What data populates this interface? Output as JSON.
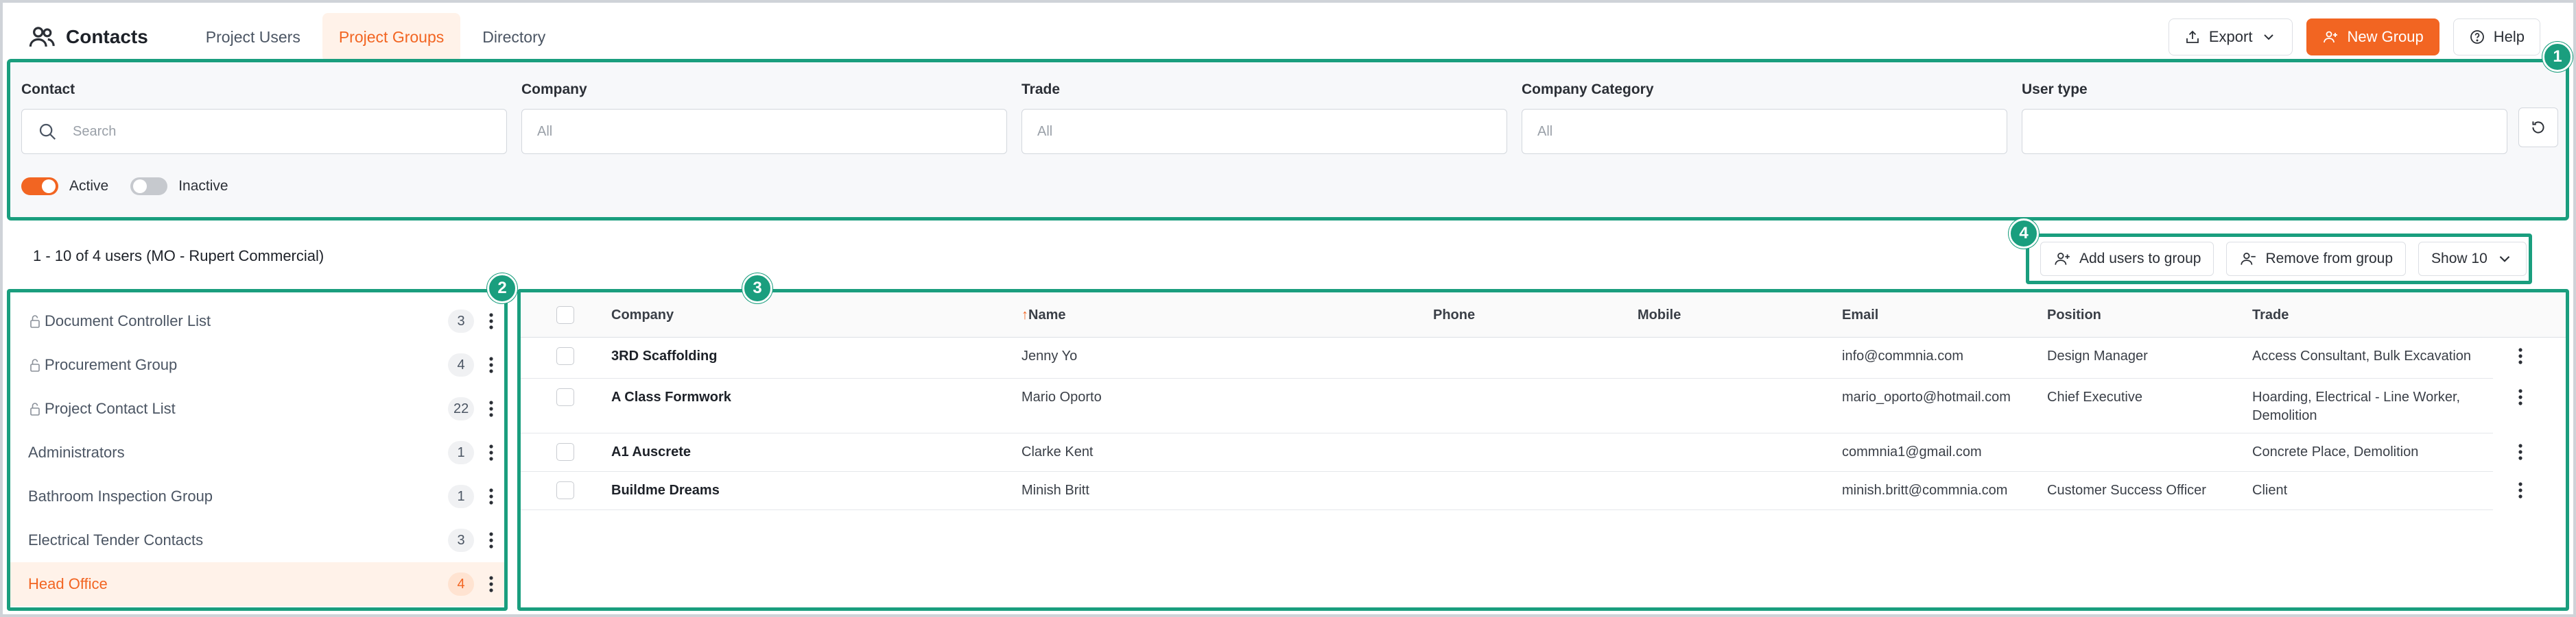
{
  "header": {
    "title": "Contacts",
    "tabs": [
      {
        "label": "Project Users",
        "active": false
      },
      {
        "label": "Project Groups",
        "active": true
      },
      {
        "label": "Directory",
        "active": false
      }
    ],
    "export_label": "Export",
    "new_group_label": "New Group",
    "help_label": "Help"
  },
  "filters": {
    "contact": {
      "label": "Contact",
      "placeholder": "Search"
    },
    "company": {
      "label": "Company",
      "placeholder": "All"
    },
    "trade": {
      "label": "Trade",
      "placeholder": "All"
    },
    "company_category": {
      "label": "Company Category",
      "placeholder": "All"
    },
    "user_type": {
      "label": "User type",
      "placeholder": ""
    },
    "active_label": "Active",
    "inactive_label": "Inactive"
  },
  "annotations": [
    "1",
    "2",
    "3",
    "4"
  ],
  "summary": "1 - 10 of 4 users (MO - Rupert Commercial)",
  "toolbar": {
    "add_label": "Add users to group",
    "remove_label": "Remove from group",
    "show_label": "Show 10"
  },
  "groups": [
    {
      "name": "Document Controller List",
      "count": "3",
      "locked": true,
      "active": false
    },
    {
      "name": "Procurement Group",
      "count": "4",
      "locked": true,
      "active": false
    },
    {
      "name": "Project Contact List",
      "count": "22",
      "locked": true,
      "active": false
    },
    {
      "name": "Administrators",
      "count": "1",
      "locked": false,
      "active": false
    },
    {
      "name": "Bathroom Inspection Group",
      "count": "1",
      "locked": false,
      "active": false
    },
    {
      "name": "Electrical Tender Contacts",
      "count": "3",
      "locked": false,
      "active": false
    },
    {
      "name": "Head Office",
      "count": "4",
      "locked": false,
      "active": true
    }
  ],
  "table": {
    "columns": {
      "company": "Company",
      "sort_arrow": "↑",
      "name": "Name",
      "phone": "Phone",
      "mobile": "Mobile",
      "email": "Email",
      "position": "Position",
      "trade": "Trade"
    },
    "rows": [
      {
        "company": "3RD Scaffolding",
        "name": "Jenny Yo",
        "phone": "",
        "mobile": "",
        "email": "info@commnia.com",
        "position": "Design Manager",
        "trade": [
          "Access Consultant, Bulk Excavation"
        ]
      },
      {
        "company": "A Class Formwork",
        "name": "Mario Oporto",
        "phone": "",
        "mobile": "",
        "email": "mario_oporto@hotmail.com",
        "position": "Chief Executive",
        "trade": [
          "Hoarding, Electrical - Line Worker,",
          "Demolition"
        ]
      },
      {
        "company": "A1 Auscrete",
        "name": "Clarke Kent",
        "phone": "",
        "mobile": "",
        "email": "commnia1@gmail.com",
        "position": "",
        "trade": [
          "Concrete Place, Demolition"
        ]
      },
      {
        "company": "Buildme Dreams",
        "name": "Minish Britt",
        "phone": "",
        "mobile": "",
        "email": "minish.britt@commnia.com",
        "position": "Customer Success Officer",
        "trade": [
          "Client"
        ]
      }
    ]
  },
  "colors": {
    "accent": "#f26522",
    "annotation": "#1a9e7e"
  }
}
